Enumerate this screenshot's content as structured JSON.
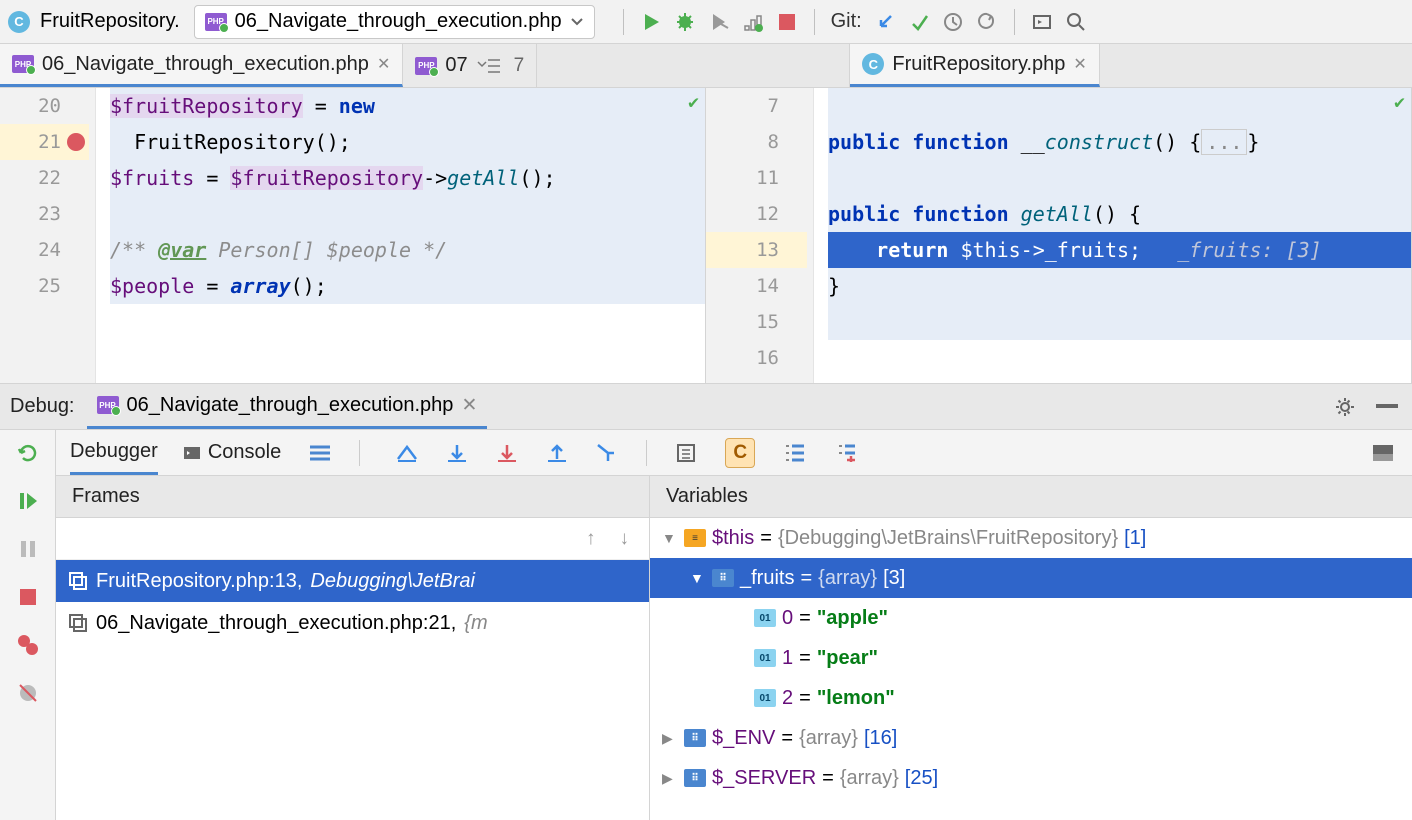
{
  "toolbar": {
    "breadcrumb": "FruitRepository.",
    "run_config": "06_Navigate_through_execution.php",
    "git_label": "Git:"
  },
  "tabs": {
    "left": {
      "label": "06_Navigate_through_execution.php"
    },
    "mid": {
      "label": "07",
      "badge": "7"
    },
    "right": {
      "label": "FruitRepository.php"
    }
  },
  "editor_left": {
    "lines": [
      "20",
      "21",
      "22",
      "23",
      "24",
      "25"
    ],
    "l20a": "$fruitRepository",
    "l20b": " = ",
    "l20c": "new",
    "l20d": "FruitRepository();",
    "l21a": "$fruits",
    "l21b": " = ",
    "l21c": "$fruitRepository",
    "l21d": "->",
    "l21e": "getAll",
    "l21f": "();",
    "l23a": "/** ",
    "l23b": "@var",
    "l23c": " Person[] $people */",
    "l24a": "$people",
    "l24b": " = ",
    "l24c": "array",
    "l24d": "();"
  },
  "editor_right": {
    "lines": [
      "7",
      "8",
      "11",
      "12",
      "13",
      "14",
      "15",
      "16"
    ],
    "l8a": "public",
    "l8b": " ",
    "l8c": "function",
    "l8d": " __",
    "l8e": "construct",
    "l8f": "() {",
    "l8g": "...",
    "l8h": "}",
    "l12a": "public",
    "l12b": " ",
    "l12c": "function",
    "l12d": " ",
    "l12e": "getAll",
    "l12f": "() {",
    "l13a": "    return",
    "l13b": " $this->",
    "l13c": "_fruits",
    "l13d": ";",
    "l13hint": "_fruits: [3]",
    "l14a": "}"
  },
  "debug": {
    "title": "Debug:",
    "tab_label": "06_Navigate_through_execution.php",
    "subtabs": {
      "debugger": "Debugger",
      "console": "Console"
    },
    "frames_header": "Frames",
    "vars_header": "Variables",
    "frames": [
      {
        "file": "FruitRepository.php:13,",
        "ctx": "Debugging\\JetBrai"
      },
      {
        "file": "06_Navigate_through_execution.php:21,",
        "ctx": "{m"
      }
    ],
    "vars": {
      "this": {
        "name": "$this",
        "eq": " = ",
        "type": "{Debugging\\JetBrains\\FruitRepository} ",
        "count": "[1]"
      },
      "fruits": {
        "name": "_fruits",
        "eq": " = ",
        "type": "{array} ",
        "count": "[3]"
      },
      "items": [
        {
          "k": "0",
          "eq": " = ",
          "v": "\"apple\""
        },
        {
          "k": "1",
          "eq": " = ",
          "v": "\"pear\""
        },
        {
          "k": "2",
          "eq": " = ",
          "v": "\"lemon\""
        }
      ],
      "env": {
        "name": "$_ENV",
        "eq": " = ",
        "type": "{array} ",
        "count": "[16]"
      },
      "server": {
        "name": "$_SERVER",
        "eq": " = ",
        "type": "{array} ",
        "count": "[25]"
      }
    }
  }
}
